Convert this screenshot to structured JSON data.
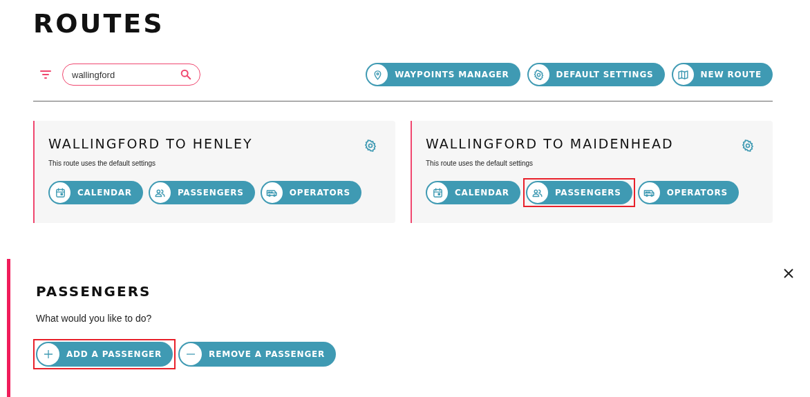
{
  "title": "ROUTES",
  "search": {
    "value": "wallingford"
  },
  "toolbar_buttons": [
    {
      "label": "WAYPOINTS MANAGER",
      "kind": "pin"
    },
    {
      "label": "DEFAULT SETTINGS",
      "kind": "gear"
    },
    {
      "label": "NEW ROUTE",
      "kind": "map"
    }
  ],
  "routes": [
    {
      "title": "WALLINGFORD TO HENLEY",
      "subtitle": "This route uses the default settings",
      "buttons": [
        {
          "label": "CALENDAR",
          "kind": "calendar",
          "highlighted": false
        },
        {
          "label": "PASSENGERS",
          "kind": "people",
          "highlighted": false
        },
        {
          "label": "OPERATORS",
          "kind": "van",
          "highlighted": false
        }
      ]
    },
    {
      "title": "WALLINGFORD TO MAIDENHEAD",
      "subtitle": "This route uses the default settings",
      "buttons": [
        {
          "label": "CALENDAR",
          "kind": "calendar",
          "highlighted": false
        },
        {
          "label": "PASSENGERS",
          "kind": "people",
          "highlighted": true
        },
        {
          "label": "OPERATORS",
          "kind": "van",
          "highlighted": false
        }
      ]
    }
  ],
  "panel": {
    "title": "PASSENGERS",
    "prompt": "What would you like to do?",
    "buttons": [
      {
        "label": "ADD A PASSENGER",
        "kind": "plus",
        "highlighted": true
      },
      {
        "label": "REMOVE A PASSENGER",
        "kind": "minus",
        "highlighted": false
      }
    ]
  }
}
